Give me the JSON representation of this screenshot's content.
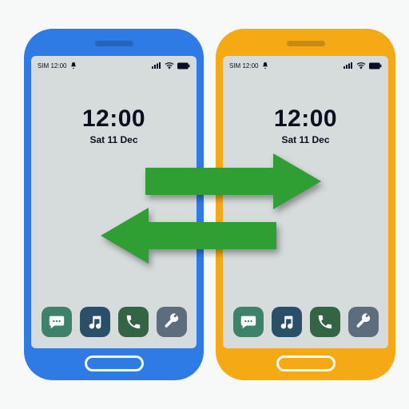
{
  "status": {
    "sim_label": "SIM 12:00"
  },
  "clock": {
    "time": "12:00",
    "date": "Sat 11 Dec"
  },
  "dock": {
    "messages": "messages",
    "music": "music",
    "phone": "phone",
    "tools": "tools"
  },
  "colors": {
    "phone_left": "#2f7be5",
    "phone_right": "#f4a915",
    "arrow": "#2f9e33",
    "screen": "#d6dbdc"
  }
}
